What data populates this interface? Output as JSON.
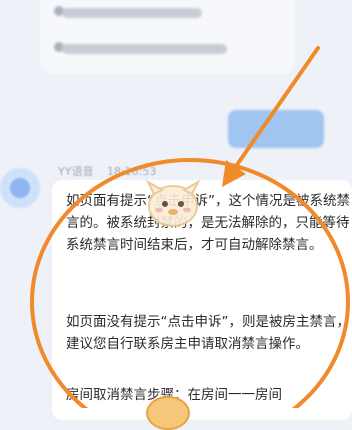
{
  "colors": {
    "accent_orange": "#f08a2a",
    "bubble_bg": "#ffffff",
    "page_bg": "#eef1f7",
    "text": "#2b2b2b",
    "button_blue": "#9fc5f0"
  },
  "message": {
    "sender": "YY语音",
    "time": "18:16:53",
    "paragraph1": "如页面有提示“点击申诉”，这个情况是被系统禁言的。被系统封禁的，是无法解除的，只能等待系统禁言时间结束后，才可自动解除禁言。",
    "paragraph2": "如页面没有提示“点击申诉”，则是被房主禁言，建议您自行联系房主申请取消禁言操作。",
    "paragraph3": "房间取消禁言步骤：在房间一一房间"
  },
  "icons": {
    "avatar": "assistant-avatar-icon",
    "mascot": "cartoon-mascot-icon",
    "arrow": "annotation-arrow-icon"
  }
}
